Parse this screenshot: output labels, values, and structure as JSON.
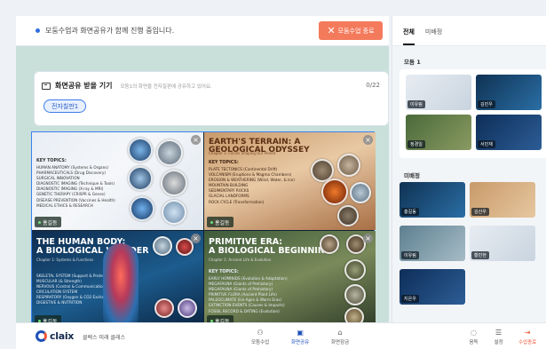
{
  "status": {
    "text": "모둠수업과 화면공유가 함께 진행 중입니다.",
    "end_button_label": "모둠수업 종료"
  },
  "share_panel": {
    "title": "화면공유 받을 기기",
    "subtitle": "모둠1의 화면을 전자칠판에 공유하고 있어요.",
    "count": "0/22",
    "chip_label": "전자칠판1"
  },
  "shared_tiles": [
    {
      "title": "",
      "subtitle": "",
      "topics_header": "KEY TOPICS:",
      "topics": [
        "HUMAN ANATOMY (Systems & Organs)",
        "PHARMACEUTICALS (Drug Discovery)",
        "SURGICAL INNOVATION",
        "DIAGNOSTIC IMAGING (Technique & Tools)",
        "DIAGNOSTIC IMAGING (X-ray & MRI)",
        "GENETIC THERAPY (CRISPR & Genes)",
        "DISEASE PREVENTION (Vaccines & Health)",
        "MEDICAL ETHICS & RESEARCH"
      ],
      "name": "홍길동"
    },
    {
      "title": "EARTH'S TERRAIN: A GEOLOGICAL ODYSSEY",
      "subtitle": "Chapter 1: Forces Shaping Our Planet",
      "topics_header": "KEY TOPICS:",
      "topics": [
        "PLATE TECTONICS (Continental Drift)",
        "VOLCANISM (Eruptions & Magma Chambers)",
        "EROSION & WEATHERING (Wind, Water, & Ice)",
        "MOUNTAIN BUILDING",
        "SEDIMENTARY ROCKS",
        "GLACIAL LANDFORMS",
        "ROCK CYCLE (Transformation)"
      ],
      "name": "홍길동"
    },
    {
      "title": "THE HUMAN BODY:\nA BIOLOGICAL WONDER",
      "subtitle": "Chapter 1: Systems & Functions",
      "topics_header": "",
      "topics": [
        "SKELETAL SYSTEM (Support & Protection)",
        "MUSCULAR (& Strength)",
        "NERVOUS (Control & Communication)",
        "CIRCULATION SYSTEM",
        "RESPIRATORY (Oxygen & CO2 Exchange)",
        "DIGESTIVE & NUTRITION"
      ],
      "name": "홍길동"
    },
    {
      "title": "PRIMITIVE ERA:\nA BIOLOGICAL BEGINNING",
      "subtitle": "Chapter 1: Ancient Life & Evolution",
      "topics_header": "KEY TOPICS:",
      "topics": [
        "EARLY HOMINIDS (Evolution & Adaptation)",
        "MEGAFAUNA (Giants of Prehistory)",
        "MEGAFAUNA (Giants of Prehistory)",
        "PRIMITIVE FLORA (Ancient Plant Life)",
        "PALEOCLIMATE (Ice Ages & Warm Eras)",
        "EXTINCTION EVENTS (Causes & Impacts)",
        "FOSSIL RECORD & DATING (Evolution)"
      ],
      "name": "홍길동"
    }
  ],
  "side": {
    "tabs": [
      "전체",
      "미배정"
    ],
    "group1_label": "모둠 1",
    "group1_members": [
      "이유림",
      "김민우",
      "정경일",
      "서민재"
    ],
    "unassigned_label": "미배정",
    "unassigned_members": [
      "홍길동",
      "김산우",
      "이유림",
      "황민현",
      "지은우"
    ]
  },
  "bottom": {
    "brand": "claix",
    "class_name": "클렉스 미래 클래스",
    "controls": [
      {
        "label": "모둠수업",
        "icon": "group-icon"
      },
      {
        "label": "화면공유",
        "icon": "screen-share-icon"
      },
      {
        "label": "화면잠금",
        "icon": "lock-icon"
      },
      {
        "label": "음독",
        "icon": "mute-icon"
      },
      {
        "label": "설정",
        "icon": "settings-icon"
      },
      {
        "label": "수업종료",
        "icon": "exit-icon"
      }
    ]
  },
  "colors": {
    "accent": "#1d4fb8",
    "end_button": "#f47a5c",
    "share_border": "#3d80f0",
    "content_bg": "#c8e0d9"
  }
}
